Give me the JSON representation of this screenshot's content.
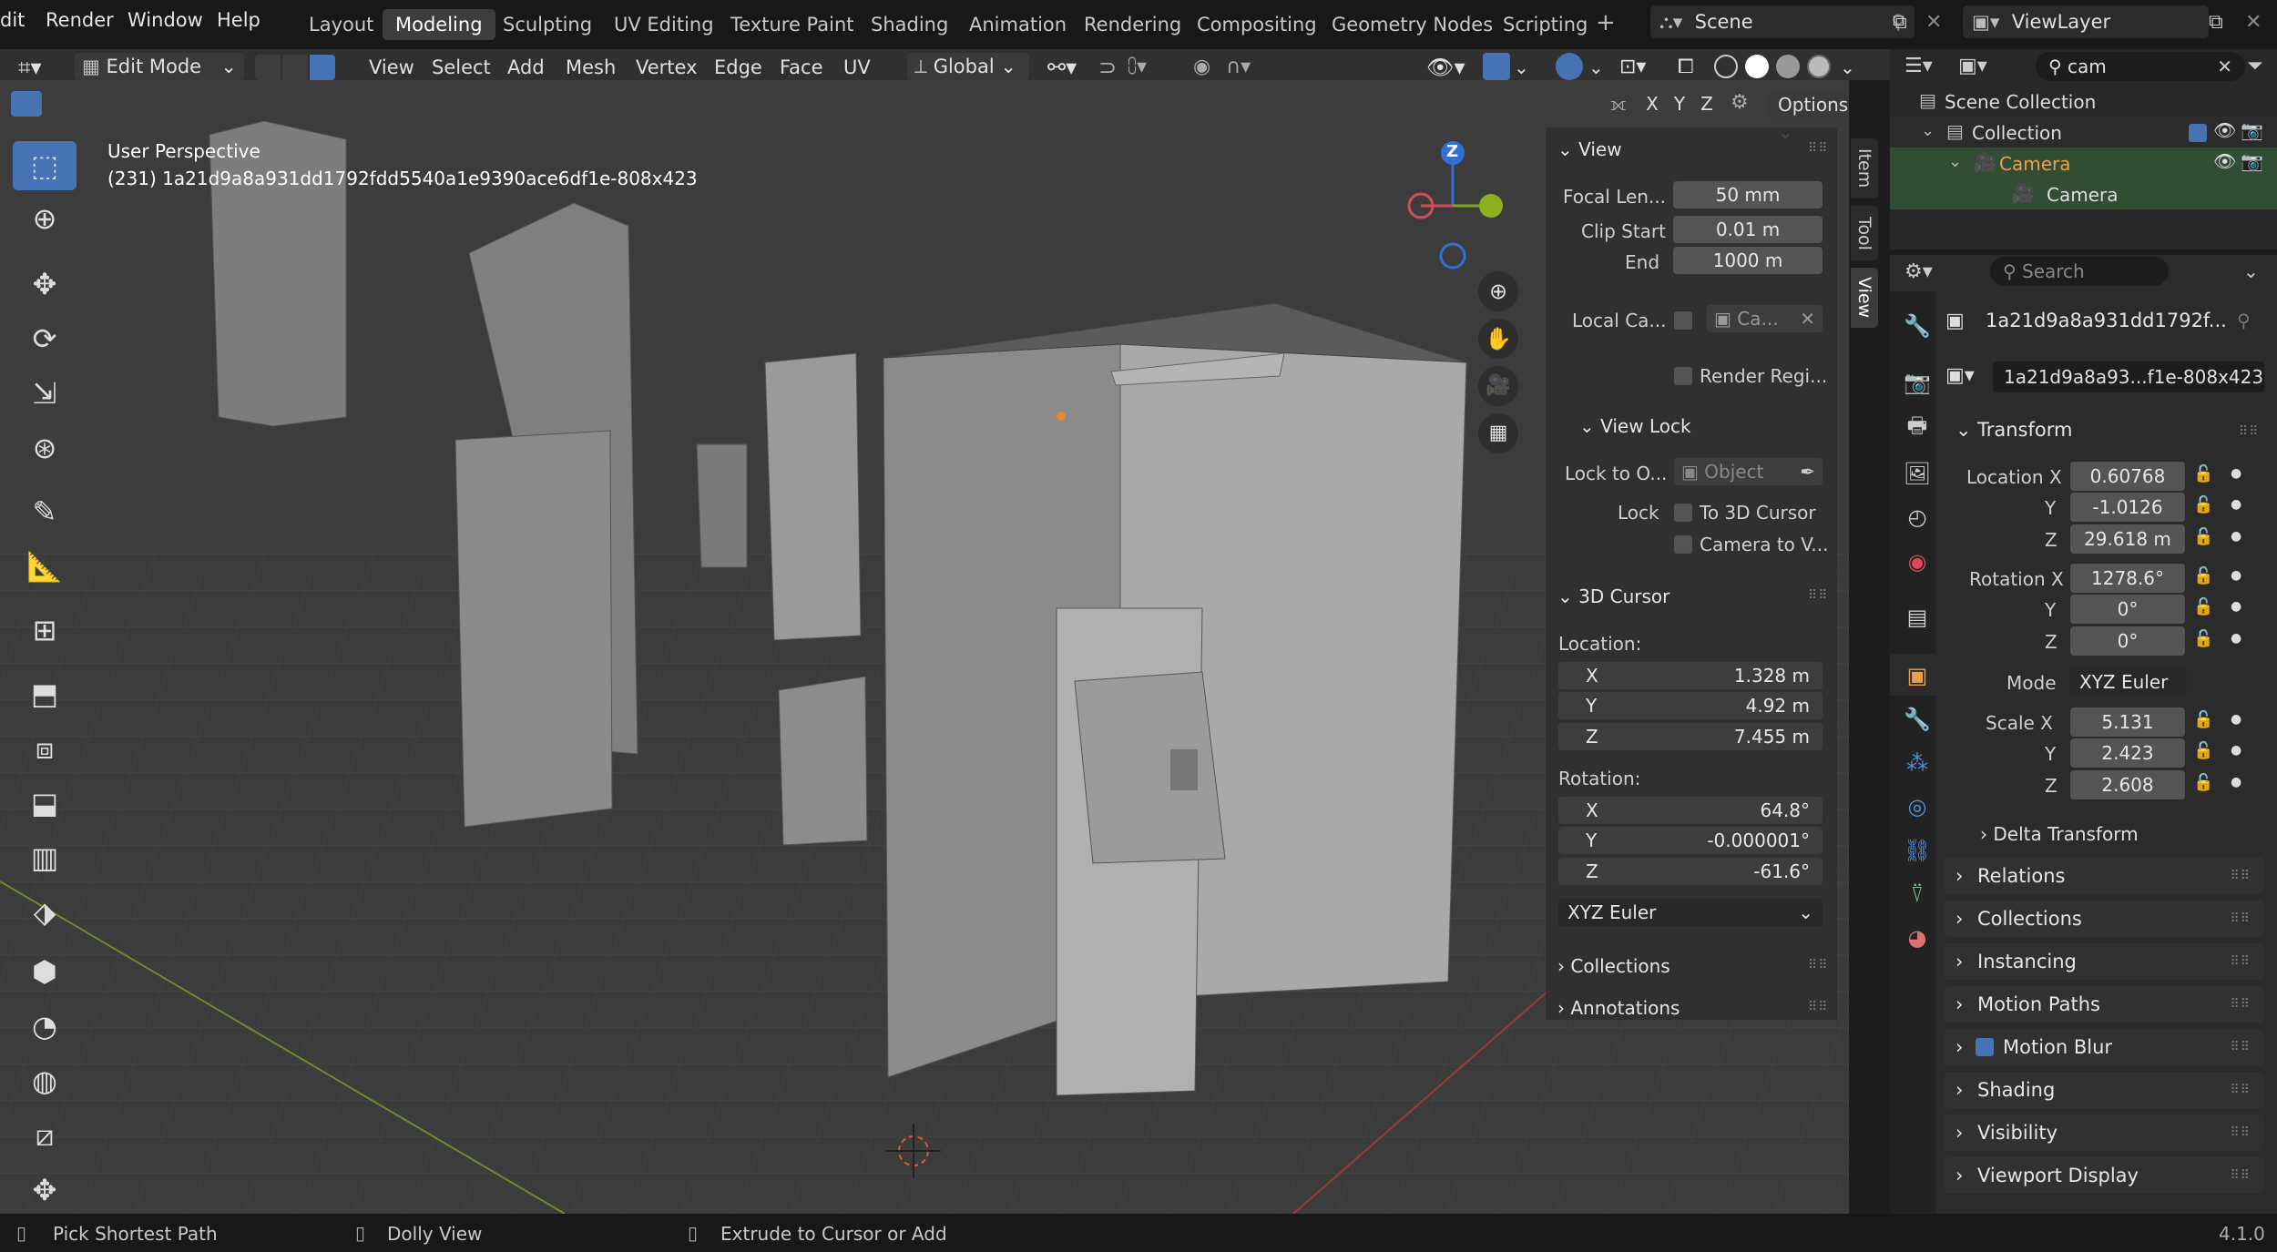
{
  "menus": [
    "dit",
    "Render",
    "Window",
    "Help"
  ],
  "workspaces": [
    "Layout",
    "Modeling",
    "Sculpting",
    "UV Editing",
    "Texture Paint",
    "Shading",
    "Animation",
    "Rendering",
    "Compositing",
    "Geometry Nodes",
    "Scripting"
  ],
  "active_workspace": "Modeling",
  "scene": "Scene",
  "view_layer": "ViewLayer",
  "header": {
    "mode": "Edit Mode",
    "menus": [
      "View",
      "Select",
      "Add",
      "Mesh",
      "Vertex",
      "Edge",
      "Face",
      "UV"
    ],
    "orientation": "Global",
    "options": "Options",
    "axes": [
      "X",
      "Y",
      "Z"
    ]
  },
  "viewport": {
    "perspective": "User Perspective",
    "object_name": "(231) 1a21d9a8a931dd1792fdd5540a1e9390ace6df1e-808x423",
    "gizmo_axis": "Z"
  },
  "npanel": {
    "tabs": [
      "Item",
      "Tool",
      "View"
    ],
    "view_title": "View",
    "focal_label": "Focal Len...",
    "focal_value": "50 mm",
    "clip_start_label": "Clip Start",
    "clip_start_value": "0.01 m",
    "clip_end_label": "End",
    "clip_end_value": "1000 m",
    "local_camera_label": "Local Ca...",
    "local_camera_value": "Ca...",
    "render_region": "Render Regi...",
    "view_lock_title": "View Lock",
    "lock_to_label": "Lock to O...",
    "lock_to_value": "Object",
    "lock_label": "Lock",
    "to_3d_cursor": "To 3D Cursor",
    "camera_to_view": "Camera to V...",
    "cursor_title": "3D Cursor",
    "location_label": "Location:",
    "loc": [
      {
        "axis": "X",
        "value": "1.328 m"
      },
      {
        "axis": "Y",
        "value": "4.92 m"
      },
      {
        "axis": "Z",
        "value": "7.455 m"
      }
    ],
    "rotation_label": "Rotation:",
    "rot": [
      {
        "axis": "X",
        "value": "64.8°"
      },
      {
        "axis": "Y",
        "value": "-0.000001°"
      },
      {
        "axis": "Z",
        "value": "-61.6°"
      }
    ],
    "rot_mode": "XYZ Euler",
    "collections": "Collections",
    "annotations": "Annotations"
  },
  "outliner": {
    "search": "cam",
    "items": [
      "Scene Collection",
      "Collection",
      "Camera",
      "Camera"
    ]
  },
  "properties": {
    "search_placeholder": "Search",
    "object_name": "1a21d9a8a931dd1792f...",
    "data_name": "1a21d9a8a93...f1e-808x423",
    "transform_title": "Transform",
    "location_x_label": "Location X",
    "location": [
      "0.60768",
      "-1.0126",
      "29.618 m"
    ],
    "rotation_x_label": "Rotation X",
    "rotation": [
      "1278.6°",
      "0°",
      "0°"
    ],
    "mode_label": "Mode",
    "mode_value": "XYZ Euler",
    "scale_x_label": "Scale X",
    "scale": [
      "5.131",
      "2.423",
      "2.608"
    ],
    "y_label": "Y",
    "z_label": "Z",
    "delta": "Delta Transform",
    "panels": [
      "Relations",
      "Collections",
      "Instancing",
      "Motion Paths",
      "Motion Blur",
      "Shading",
      "Visibility",
      "Viewport Display"
    ]
  },
  "status": {
    "left": "Pick Shortest Path",
    "middle": "Dolly View",
    "right": "Extrude to Cursor or Add",
    "version": "4.1.0"
  }
}
